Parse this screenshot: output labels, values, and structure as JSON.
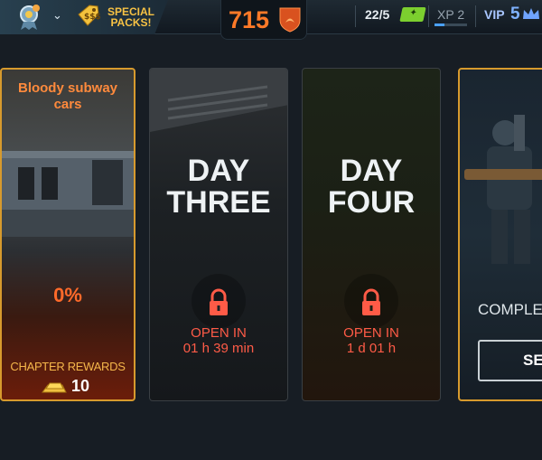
{
  "topbar": {
    "special_packs": "SPECIAL\nPACKS!",
    "coins": "715",
    "energy": "22/5",
    "xp": "XP 2",
    "vip_label": "VIP",
    "vip_level": "5",
    "xp_progress": 0.3
  },
  "cards": [
    {
      "title": "Bloody subway\ncars",
      "progress": "0%",
      "rewards_label": "CHAPTER REWARDS",
      "rewards_value": "10"
    },
    {
      "title": "DAY\nTHREE",
      "status_line1": "OPEN IN",
      "status_line2": "01 h 39 min"
    },
    {
      "title": "DAY\nFOUR",
      "status_line1": "OPEN IN",
      "status_line2": "1 d 01 h"
    },
    {
      "text": "COMPLET",
      "button": "SE"
    }
  ],
  "colors": {
    "accent_orange": "#ff7a28",
    "lock_red": "#ff5b47",
    "gold_border": "#d79a2d"
  }
}
